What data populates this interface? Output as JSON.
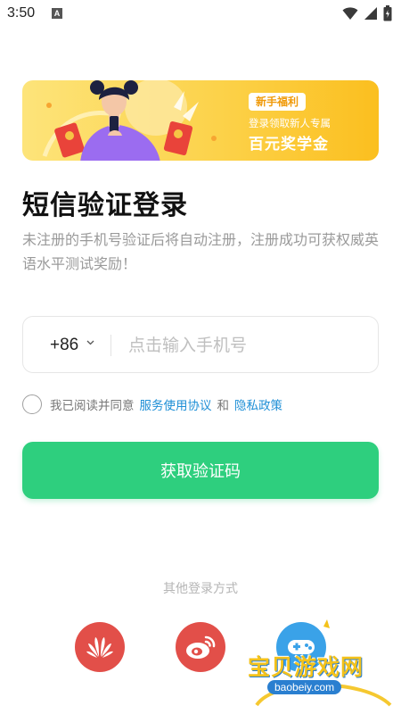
{
  "status_bar": {
    "time": "3:50",
    "notification_letter": "A"
  },
  "banner": {
    "tag": "新手福利",
    "subtitle": "登录领取新人专属",
    "headline": "百元奖学金"
  },
  "login": {
    "title": "短信验证登录",
    "subtitle": "未注册的手机号验证后将自动注册，注册成功可获权威英语水平测试奖励！",
    "country_code": "+86",
    "phone_placeholder": "点击输入手机号",
    "agreement_prefix": "我已阅读并同意",
    "agreement_service": "服务使用协议",
    "agreement_and": "和",
    "agreement_privacy": "隐私政策",
    "submit_label": "获取验证码"
  },
  "other_login": {
    "label": "其他登录方式",
    "providers": [
      "huawei-icon",
      "weibo-icon",
      "game-controller-icon"
    ]
  },
  "watermark": {
    "text": "宝贝游戏网",
    "url": "baobeiy.com"
  },
  "colors": {
    "primary_green": "#2ecf7e",
    "link_blue": "#1e8fd6",
    "banner_yellow": "#fcd24a",
    "provider_red": "#e24f49"
  }
}
